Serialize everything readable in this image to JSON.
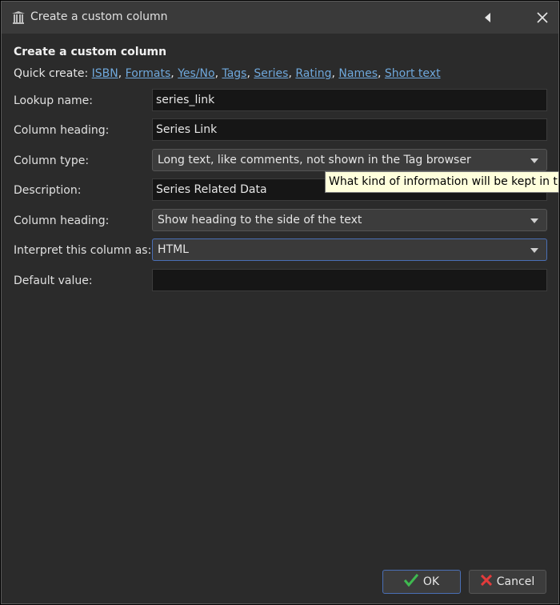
{
  "window": {
    "title": "Create a custom column"
  },
  "header": {
    "heading": "Create a custom column",
    "quick_create_label": "Quick create:",
    "quick_links": [
      "ISBN",
      "Formats",
      "Yes/No",
      "Tags",
      "Series",
      "Rating",
      "Names",
      "Short text"
    ]
  },
  "form": {
    "lookup_name": {
      "label": "Lookup name:",
      "value": "series_link"
    },
    "column_heading": {
      "label": "Column heading:",
      "value": "Series Link"
    },
    "column_type": {
      "label": "Column type:",
      "value": "Long text, like comments, not shown in the Tag browser"
    },
    "description": {
      "label": "Description:",
      "value": "Series Related Data"
    },
    "heading_position": {
      "label": "Column heading:",
      "value": "Show heading to the side of the text"
    },
    "interpret_as": {
      "label": "Interpret this column as:",
      "value": "HTML"
    },
    "default_value": {
      "label": "Default value:",
      "value": ""
    }
  },
  "tooltip": {
    "text": "What kind of information will be kept in the"
  },
  "buttons": {
    "ok": "OK",
    "cancel": "Cancel"
  },
  "colors": {
    "link": "#6fa8dc",
    "ok_check": "#3fb950",
    "cancel_x": "#e23b3b",
    "focus_border": "#4a6fb5"
  }
}
